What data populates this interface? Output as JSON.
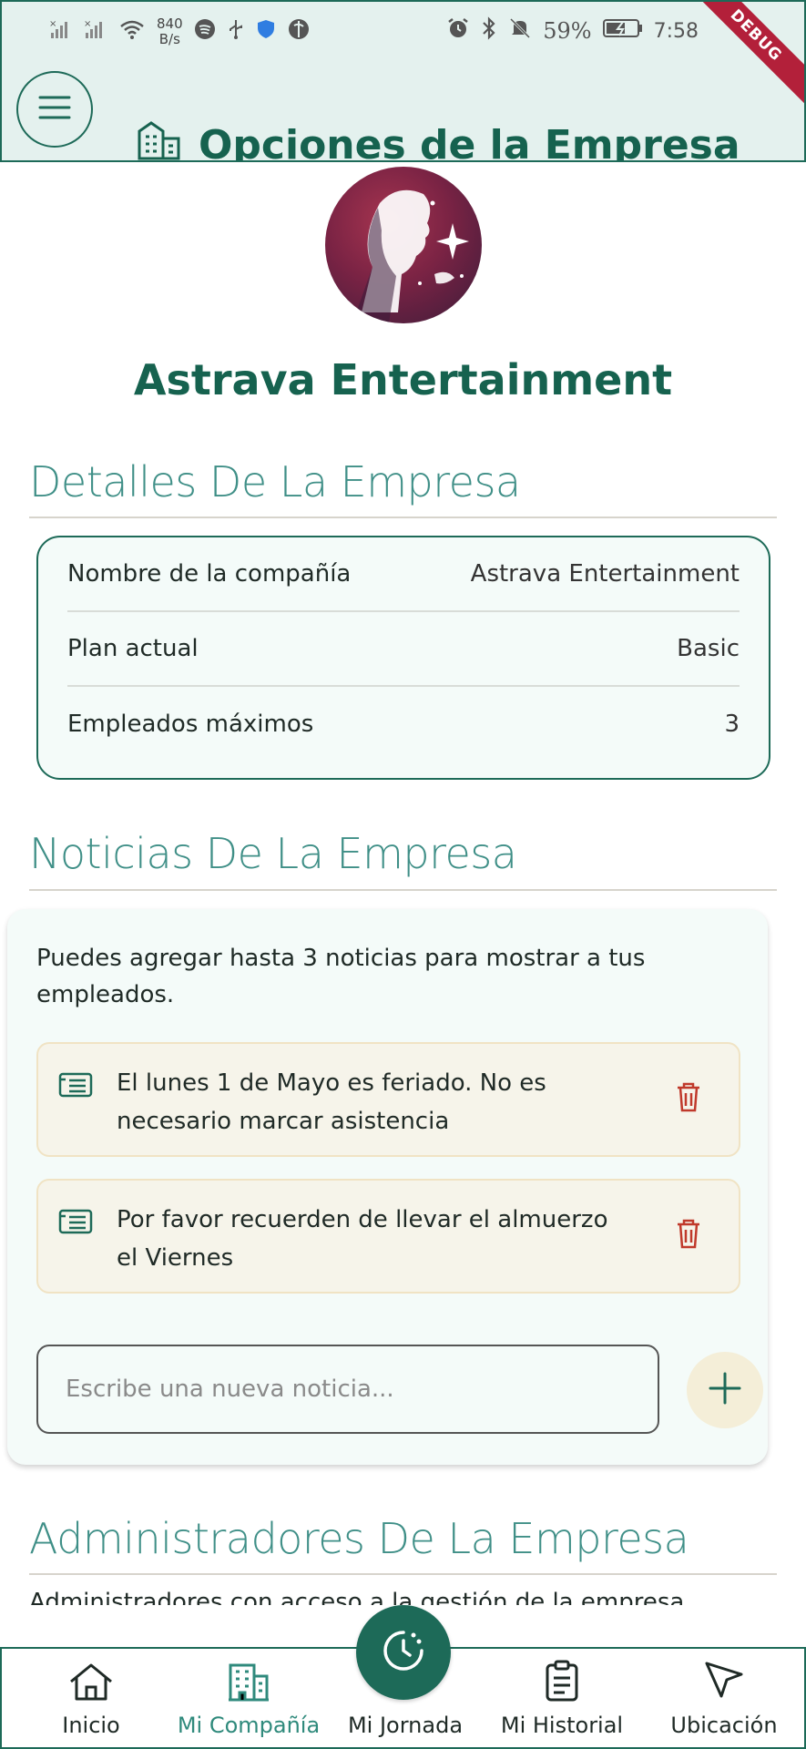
{
  "status_bar": {
    "net_speed_value": "840",
    "net_speed_unit": "B/s",
    "battery": "59%",
    "time": "7:58",
    "debug_label": "DEBUG"
  },
  "app_bar": {
    "title": "Opciones de la Empresa",
    "menu_icon": "hamburger-icon",
    "title_icon": "building-icon"
  },
  "company": {
    "name": "Astrava Entertainment"
  },
  "details": {
    "section_title": "Detalles De La Empresa",
    "rows": [
      {
        "key": "Nombre de la compañía",
        "value": "Astrava Entertainment"
      },
      {
        "key": "Plan actual",
        "value": "Basic"
      },
      {
        "key": "Empleados máximos",
        "value": "3"
      }
    ]
  },
  "news": {
    "section_title": "Noticias De La Empresa",
    "intro": "Puedes agregar hasta 3 noticias para mostrar a tus empleados.",
    "items": [
      {
        "text": "El lunes 1 de Mayo es feriado. No es necesario marcar asistencia"
      },
      {
        "text": "Por favor recuerden de llevar el almuerzo el Viernes"
      }
    ],
    "input_placeholder": "Escribe una nueva noticia..."
  },
  "admins": {
    "section_title": "Administradores De La Empresa",
    "subtitle": "Administradores con acceso a la gestión de la empresa"
  },
  "bottom_nav": {
    "items": [
      {
        "label": "Inicio",
        "icon": "home-icon"
      },
      {
        "label": "Mi Compañía",
        "icon": "building-icon"
      },
      {
        "label": "Mi Jornada",
        "icon": "clock-icon"
      },
      {
        "label": "Mi Historial",
        "icon": "clipboard-icon"
      },
      {
        "label": "Ubicación",
        "icon": "navigation-arrow-icon"
      }
    ]
  },
  "colors": {
    "primary": "#1d6a58",
    "accent_text": "#3f8f87",
    "delete": "#c0392b"
  }
}
